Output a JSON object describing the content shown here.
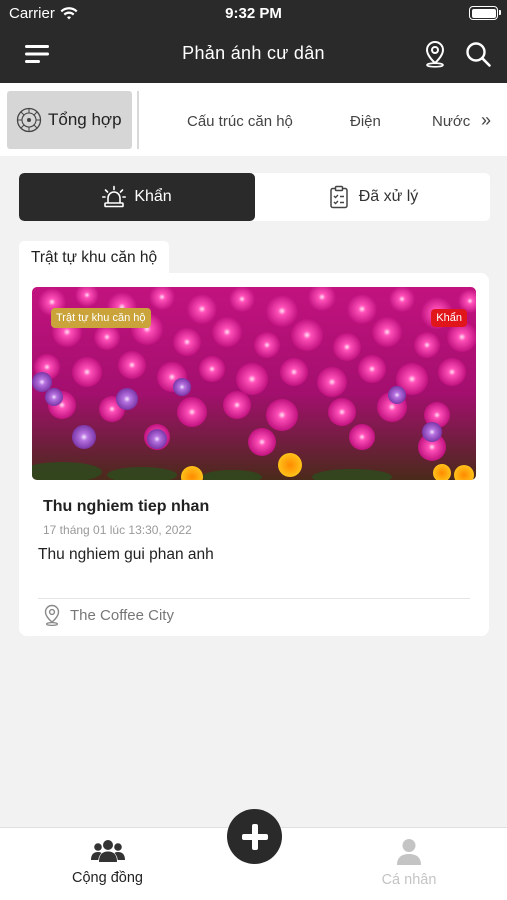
{
  "status_bar": {
    "carrier": "Carrier",
    "time": "9:32 PM",
    "icons": [
      "wifi-icon",
      "battery-icon"
    ]
  },
  "nav": {
    "title": "Phản ánh cư dân",
    "icons": [
      "menu-icon",
      "location-pin-icon",
      "search-icon"
    ]
  },
  "categories": {
    "selected": "Tổng hợp",
    "items": [
      "Tổng hợp",
      "Cấu trúc căn hộ",
      "Điện",
      "Nước"
    ],
    "more_icon": "double-chevron-right-icon"
  },
  "segment": {
    "urgent_label": "Khẩn",
    "done_label": "Đã xử lý",
    "active": "Khẩn"
  },
  "section": {
    "title": "Trật tự khu căn hộ"
  },
  "card": {
    "category_badge": "Trật tự khu căn hộ",
    "urgent_badge": "Khẩn",
    "title": "Thu nghiem tiep nhan",
    "date": "17 tháng 01 lúc 13:30, 2022",
    "description": "Thu nghiem gui phan anh",
    "location": "The Coffee City",
    "image": "photo of pink and purple flowers"
  },
  "tab_bar": {
    "community_label": "Cộng đồng",
    "profile_label": "Cá nhân",
    "add_icon": "plus-icon"
  },
  "colors": {
    "dark": "#2b2a2a",
    "badge_gold": "#caa43a",
    "badge_red": "#e1161b",
    "inactive": "#c4c4c4"
  }
}
